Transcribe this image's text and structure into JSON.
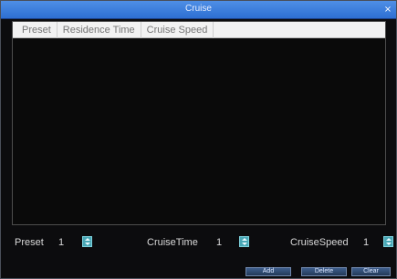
{
  "window": {
    "title": "Cruise",
    "close_glyph": "×"
  },
  "table": {
    "headers": [
      "Preset",
      "Residence Time",
      "Cruise Speed"
    ]
  },
  "controls": {
    "preset_label": "Preset",
    "preset_value": "1",
    "cruise_time_label": "CruiseTime",
    "cruise_time_value": "1",
    "cruise_speed_label": "CruiseSpeed",
    "cruise_speed_value": "1"
  },
  "buttons": {
    "add": "Add",
    "delete": "Delete",
    "clear": "Clear"
  },
  "colors": {
    "titlebar": "#3b7fe0",
    "spin": "#49a7b5",
    "button": "#2f4f7a"
  },
  "icons": {
    "close": "close-icon",
    "spin": "spin-arrows-icon"
  }
}
